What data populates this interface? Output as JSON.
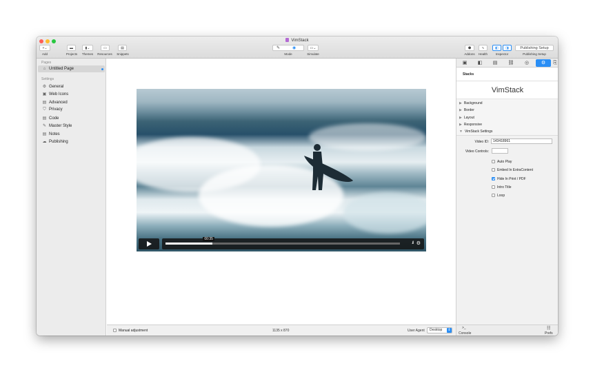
{
  "window": {
    "title": "VimStack"
  },
  "toolbar": {
    "left": [
      {
        "label": "Add",
        "icon": "+⌄"
      },
      {
        "label": "Projects",
        "icon": "▬"
      },
      {
        "label": "Themes",
        "icon": "▮⌄"
      },
      {
        "label": "Resources",
        "icon": "▭"
      },
      {
        "label": "Snippets",
        "icon": "▤"
      }
    ],
    "mode_label": "Mode",
    "simulate_label": "Simulate",
    "right": {
      "addons_label": "Addons",
      "health_label": "Health",
      "inspector_label": "Inspector",
      "publishing_button": "Publishing Setup",
      "publishing_label": "Publishing Setup"
    }
  },
  "sidebar": {
    "pages_header": "Pages",
    "page": "Untitled Page",
    "settings_header": "Settings",
    "items": [
      {
        "label": "General",
        "icon": "⚙"
      },
      {
        "label": "Web Icons",
        "icon": "▣"
      },
      {
        "label": "Advanced",
        "icon": "▤"
      },
      {
        "label": "Privacy",
        "icon": "⛉"
      },
      {
        "label": "Code",
        "icon": "▤"
      },
      {
        "label": "Master Style",
        "icon": "✎"
      },
      {
        "label": "Notes",
        "icon": "▤"
      },
      {
        "label": "Publishing",
        "icon": "☁"
      }
    ]
  },
  "video": {
    "time": "00:35",
    "progress": 0.2
  },
  "statusbar": {
    "manual": "Manual adjustment",
    "size": "1135 x 870",
    "user_agent_label": "User Agent",
    "user_agent_value": "Desktop"
  },
  "inspector": {
    "stacks": "Stacks",
    "stack_title": "VimStack",
    "sections": [
      "Background",
      "Border",
      "Layout",
      "Responsive"
    ],
    "settings_section": "VimStack Settings",
    "video_id_label": "Video ID:",
    "video_id_value": "143418961",
    "video_controls_label": "Video Controls:",
    "options": [
      {
        "label": "Auto Play",
        "checked": false
      },
      {
        "label": "Embed In ExtraContent",
        "checked": false
      },
      {
        "label": "Hide In Print / PDF",
        "checked": true
      },
      {
        "label": "Intro Title",
        "checked": false
      },
      {
        "label": "Loop",
        "checked": false
      }
    ],
    "console_label": "Console",
    "prefs_label": "Prefs"
  },
  "colors": {
    "accent": "#2a8ef5",
    "close": "#fe5f57",
    "minimize": "#febc2e",
    "zoom": "#28c840"
  }
}
